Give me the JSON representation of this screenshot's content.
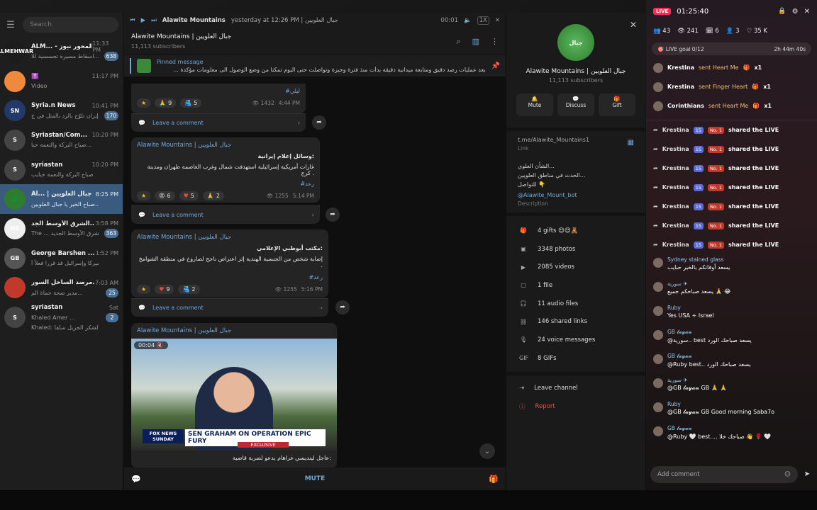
{
  "chatlist": {
    "search_placeholder": "Search",
    "items": [
      {
        "name": "ALM... - المحور نيوز",
        "time": "11:33 PM",
        "preview": "اسقاط مسيرة تجسسية للا...",
        "badge": "638",
        "av": "#1c1c1c",
        "avtext": "ALMEHWAR"
      },
      {
        "name": "✝️",
        "time": "11:17 PM",
        "preview": "Video",
        "badge": "",
        "av": "#ef8a3c",
        "avtext": ""
      },
      {
        "name": "Syria.n News",
        "time": "10:41 PM",
        "preview": "إيران تلوّح بالرد بالمثل في ج...",
        "badge": "170",
        "av": "#223a6a",
        "avtext": "SN"
      },
      {
        "name": "Syriastan/Com...",
        "time": "10:20 PM",
        "preview": "صباح البركة والنعمة حيا...",
        "badge": "",
        "av": "#444",
        "avtext": "S"
      },
      {
        "name": "syriastan",
        "time": "10:20 PM",
        "preview": "صباح البركة والنعمة حبايب",
        "badge": "",
        "av": "#444",
        "avtext": "S"
      },
      {
        "name": "Al... | جبال العلويين",
        "time": "8:25 PM",
        "preview": "صباح الخير يا جبال العلويين.......",
        "badge": "",
        "av": "#2e7d2e",
        "avtext": "🌲"
      },
      {
        "name": "الشرق الأوسط الجد...",
        "time": "3:58 PM",
        "preview": "The ... الشرق الأوسط الجديد",
        "badge": "363",
        "av": "#eeeeee",
        "avtext": "ME"
      },
      {
        "name": "George Barshen ...",
        "time": "1:52 PM",
        "preview": "أميركا وإسرائيل قد قررا فعلاً أ...",
        "badge": "",
        "av": "#555",
        "avtext": "GB"
      },
      {
        "name": "مرصد الساحل السور...",
        "time": "7:03 AM",
        "preview": "مدير صحة حماة الم...",
        "badge": "25",
        "av": "#c0392b",
        "avtext": ""
      },
      {
        "name": "syriastan",
        "time": "Sat",
        "preview": "Khaled   Amer ...",
        "badge": "2",
        "av": "#444",
        "avtext": "S"
      }
    ],
    "last_sub": "Khaled: الشكر الجزيل سلفاً"
  },
  "player": {
    "title": "Alawite Mountains",
    "meta": "yesterday at 12:26 PM | جبال العلويين",
    "time": "00:01",
    "speed": "1X"
  },
  "header": {
    "title": "Alawite Mountains | جبال العلويين",
    "subs": "11,113 subscribers"
  },
  "pinned": {
    "label": "Pinned message",
    "text": "بعد عمليات رصد دقيق ومتابعة ميدانية دقيقة بدأت منذ فترة وجيزة وتواصلت حتى اليوم تمكنا من وضع الوصول الى معلومات مؤكدة ..."
  },
  "messages": [
    {
      "hashtag": "#ليلي",
      "react1": "9",
      "react2": "5",
      "views": "1432",
      "time": "4:44 PM",
      "comment": "Leave a comment"
    },
    {
      "from": "Alawite Mountains | جبال العلويين",
      "title": "وسائل إعلام إيرانية:",
      "body": "غارات أمريكية إسرائيلية استهدفت شمال وغرب العاصمة طهران ومدينة كرج .",
      "hashtag": "#رعد",
      "r1": "6",
      "r2": "5",
      "r3": "2",
      "views": "1255",
      "time": "5:14 PM",
      "comment": "Leave a comment"
    },
    {
      "from": "Alawite Mountains | جبال العلويين",
      "title": "مكتب أبوظبي الإعلامي:",
      "body": "إصابة شخص من الجنسية الهندية إثر اعتراض ناجح لصاروخ في منطقة الشوامخ .",
      "hashtag": "#رعد",
      "r1": "9",
      "r2": "2",
      "views": "1255",
      "time": "5:16 PM",
      "comment": "Leave a comment"
    },
    {
      "from": "Alawite Mountains | جبال العلويين",
      "video_time": "00:04",
      "banner_top": "FOX NEWS SUNDAY",
      "banner": "SEN GRAHAM ON OPERATION EPIC FURY",
      "banner_sub": "EXCLUSIVE",
      "caption": "عاجل لينديسي غراهام يدعو لضربة قاضية:"
    }
  ],
  "footer": {
    "mute": "MUTE"
  },
  "info": {
    "name": "Alawite Mountains | جبال العلويين",
    "subs": "11,113 subscribers",
    "actions": [
      "Mute",
      "Discuss",
      "Gift"
    ],
    "link": "t.me/Alawite_Mountains1",
    "link_label": "Link",
    "desc_lines": [
      "الشأن العلوي...",
      "الحدث في مناطق العلويين...",
      "للتواصل 👇"
    ],
    "bot": "@Alawite_Mount_bot",
    "desc_label": "Description",
    "stats": [
      "4 gifts 😍😍🧸",
      "3348 photos",
      "2085 videos",
      "1 file",
      "11 audio files",
      "146 shared links",
      "24 voice messages",
      "8 GIFs"
    ],
    "leave": "Leave channel",
    "report": "Report"
  },
  "live": {
    "badge": "LIVE",
    "timer": "01:25:40",
    "stats": [
      "43",
      "241",
      "6",
      "3",
      "35 K"
    ],
    "goal": "LIVE goal 0/12",
    "goal_time": "2h 44m 40s",
    "gifts": [
      {
        "user": "Krestina",
        "text": "sent Heart Me",
        "count": "x1"
      },
      {
        "user": "Krestina",
        "text": "sent Finger Heart",
        "count": "x1"
      },
      {
        "user": "Corinthians",
        "text": "sent Heart Me",
        "count": "x1"
      }
    ],
    "shares_user": "Krestina",
    "shares_lvl": "15",
    "shares_no": "No. 1",
    "shares_text": "shared the LIVE",
    "comments": [
      {
        "user": "Sydney stained glass",
        "text": "يسعد أوقاتكم بالخير حبايب"
      },
      {
        "user": "سورية ✈",
        "text": "يسعد صباحكم جميع 🙏 😂"
      },
      {
        "user": "Ruby",
        "text": "Yes USA + Israel"
      },
      {
        "user": "GB 𝓵𝓪𝔂𝓪𝓷",
        "text": "@سورية.. best يسعد صباحك الورد"
      },
      {
        "user": "GB 𝓵𝓪𝔂𝓪𝓷",
        "text": "@Ruby best.. يسعد صباحك الورد"
      },
      {
        "user": "سورية ✈",
        "text": "@GB 𝓵𝓪𝔂𝓪𝓷 GB 🙏 🙏"
      },
      {
        "user": "Ruby",
        "text": "@GB 𝓵𝓪𝔂𝓪𝓷 GB Good morning Saba7o"
      },
      {
        "user": "GB 𝓵𝓪𝔂𝓪𝓷",
        "text": "@Ruby 🤍 best.... صباحك خلا 👋 🌹 🤍"
      }
    ],
    "add_comment": "Add comment"
  }
}
